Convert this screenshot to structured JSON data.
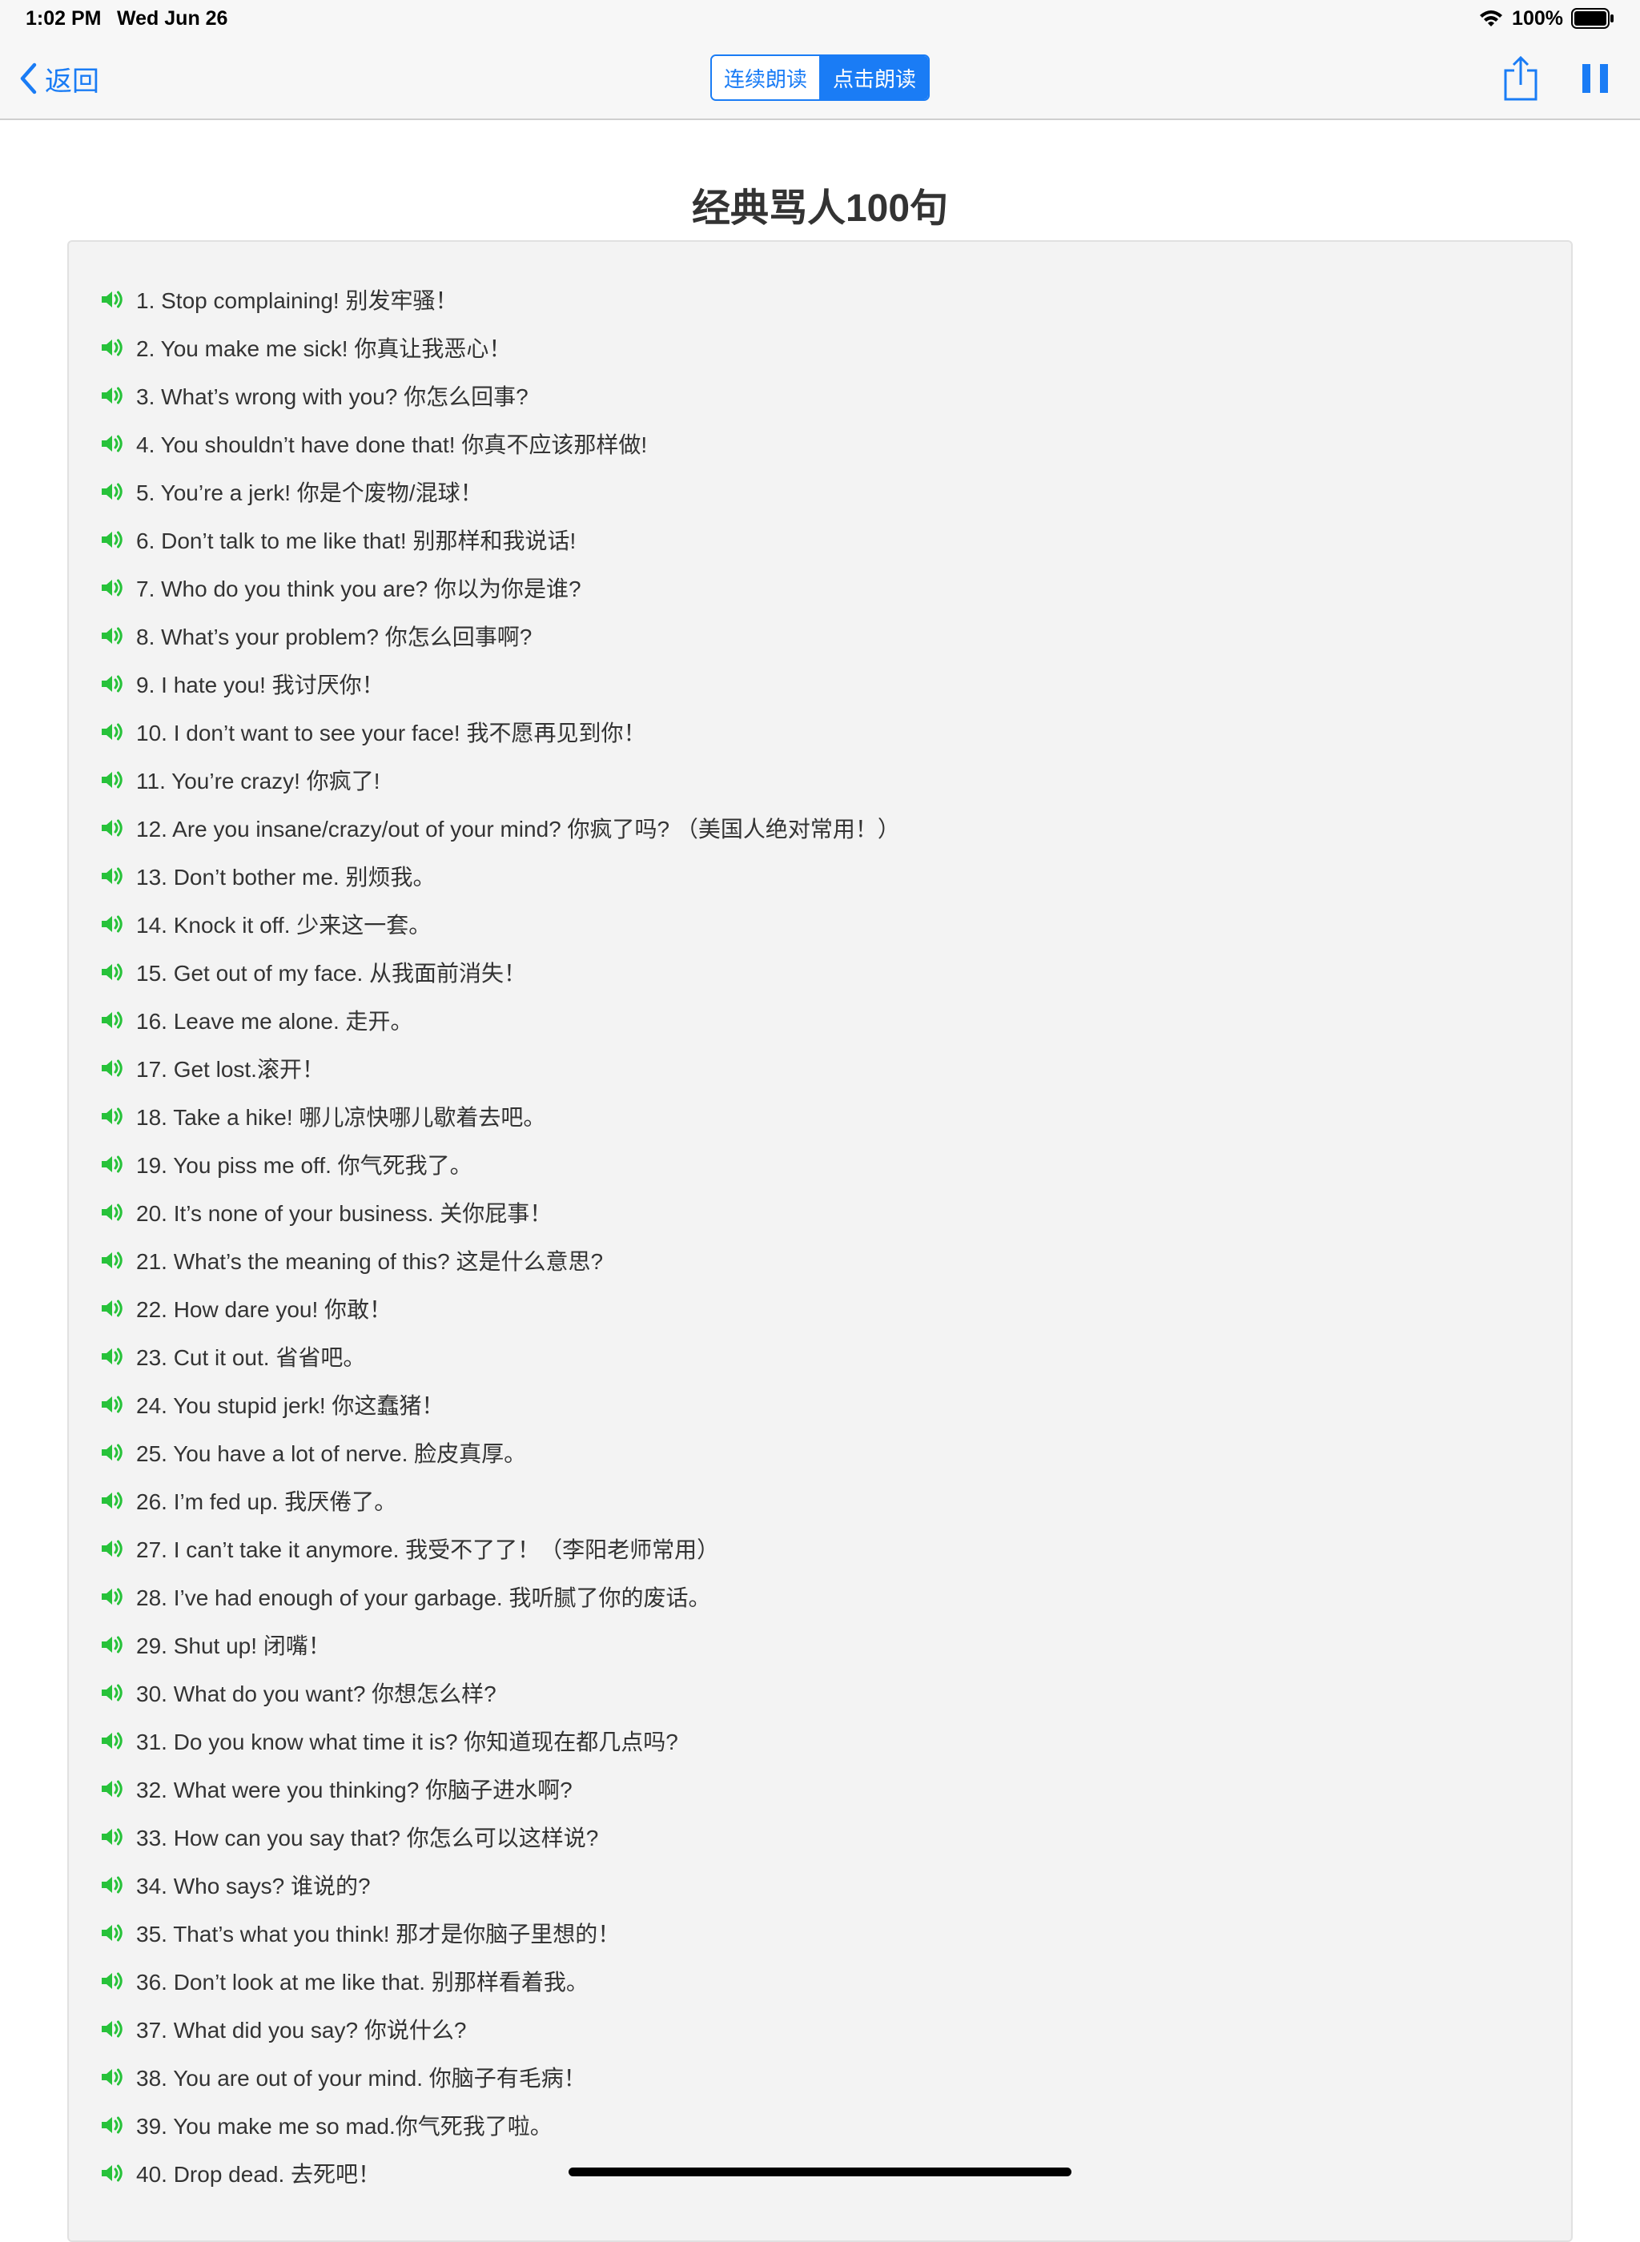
{
  "status_bar": {
    "time": "1:02 PM",
    "date": "Wed Jun 26",
    "battery": "100%"
  },
  "nav": {
    "back_label": "返回",
    "segments": [
      "连续朗读",
      "点击朗读"
    ],
    "selected_segment": "点击朗读",
    "accent_color": "#1a7cf5"
  },
  "title": "经典骂人100句",
  "icons": {
    "speaker": "speaker-volume-icon",
    "speaker_color": "#27c23a",
    "share": "share-icon",
    "pause": "pause-icon",
    "back": "chevron-left-icon"
  },
  "items": [
    "1. Stop complaining! 别发牢骚！",
    "2. You make me sick! 你真让我恶心！",
    "3. What’s wrong with you? 你怎么回事?",
    "4. You shouldn’t have done that! 你真不应该那样做!",
    "5. You’re a jerk! 你是个废物/混球！",
    "6. Don’t talk to me like that! 别那样和我说话!",
    "7. Who do you think you are? 你以为你是谁?",
    "8. What’s your problem? 你怎么回事啊?",
    "9. I hate you! 我讨厌你！",
    "10. I don’t want to see your face! 我不愿再见到你！",
    "11. You’re crazy! 你疯了!",
    "12. Are you insane/crazy/out of your mind? 你疯了吗? （美国人绝对常用！）",
    "13. Don’t bother me. 别烦我。",
    "14. Knock it off. 少来这一套。",
    "15. Get out of my face. 从我面前消失！",
    "16. Leave me alone. 走开。",
    "17. Get lost.滚开！",
    "18. Take a hike! 哪儿凉快哪儿歇着去吧。",
    "19. You piss me off. 你气死我了。",
    "20. It’s none of your business. 关你屁事！",
    "21. What’s the meaning of this? 这是什么意思?",
    "22. How dare you! 你敢！",
    "23. Cut it out. 省省吧。",
    "24. You stupid jerk! 你这蠢猪！",
    "25. You have a lot of nerve. 脸皮真厚。",
    "26. I’m fed up. 我厌倦了。",
    "27. I can’t take it anymore. 我受不了了！（李阳老师常用）",
    "28. I’ve had enough of your garbage. 我听腻了你的废话。",
    "29. Shut up! 闭嘴！",
    "30. What do you want? 你想怎么样?",
    "31. Do you know what time it is? 你知道现在都几点吗?",
    "32. What were you thinking? 你脑子进水啊?",
    "33. How can you say that? 你怎么可以这样说?",
    "34. Who says? 谁说的?",
    "35. That’s what you think! 那才是你脑子里想的！",
    "36. Don’t look at me like that. 别那样看着我。",
    "37. What did you say? 你说什么?",
    "38. You are out of your mind. 你脑子有毛病！",
    "39. You make me so mad.你气死我了啦。",
    "40. Drop dead. 去死吧！"
  ]
}
